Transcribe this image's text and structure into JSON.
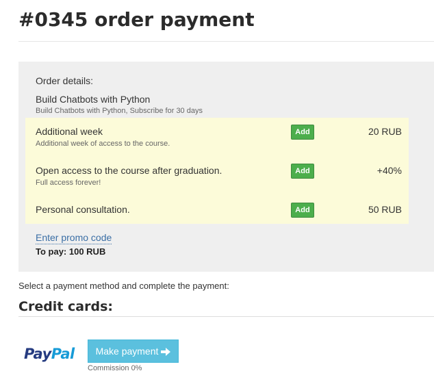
{
  "page": {
    "title": "#0345 order payment"
  },
  "order": {
    "label": "Order details:",
    "product_name": "Build Chatbots with Python",
    "product_desc": "Build Chatbots with Python, Subscribe for 30 days",
    "addons": [
      {
        "name": "Additional week",
        "desc": "Additional week of access to the course.",
        "button": "Add",
        "price": "20 RUB"
      },
      {
        "name": "Open access to the course after graduation.",
        "desc": "Full access forever!",
        "button": "Add",
        "price": "+40%"
      },
      {
        "name": "Personal consultation.",
        "desc": "",
        "button": "Add",
        "price": "50 RUB"
      }
    ],
    "promo_link": "Enter promo code",
    "to_pay": "To pay: 100 RUB"
  },
  "payment": {
    "instruction": "Select a payment method and complete the payment:",
    "section_title": "Credit cards:",
    "provider_logo": {
      "part1": "Pay",
      "part2": "Pal"
    },
    "button_label": "Make payment",
    "commission": "Commission 0%"
  },
  "colors": {
    "order_bg": "#efefef",
    "addons_bg": "#fcfbd9",
    "add_button": "#4cae4c",
    "pay_button": "#5bc0de",
    "link": "#3a6ea5"
  },
  "icons": {
    "pay_button_icon": "arrow-right-icon"
  }
}
